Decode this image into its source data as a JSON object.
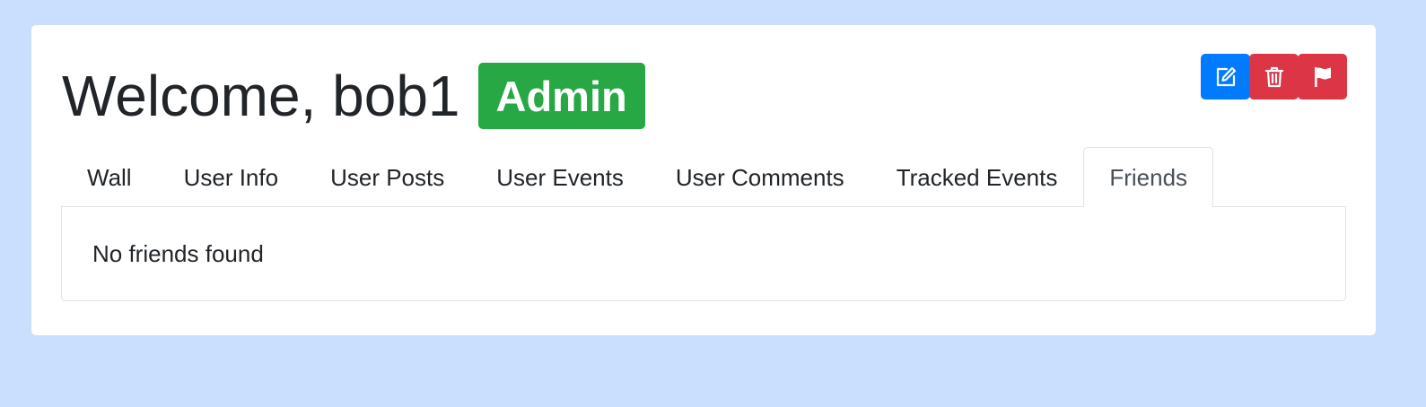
{
  "header": {
    "welcome_text": "Welcome, bob1",
    "role_badge": "Admin"
  },
  "actions": [
    {
      "icon": "edit-icon",
      "color": "#007bff"
    },
    {
      "icon": "trash-icon",
      "color": "#dc3545"
    },
    {
      "icon": "flag-icon",
      "color": "#dc3545"
    }
  ],
  "tabs": [
    {
      "label": "Wall"
    },
    {
      "label": "User Info"
    },
    {
      "label": "User Posts"
    },
    {
      "label": "User Events"
    },
    {
      "label": "User Comments"
    },
    {
      "label": "Tracked Events"
    },
    {
      "label": "Friends",
      "active": true
    }
  ],
  "content": {
    "empty_message": "No friends found"
  },
  "colors": {
    "page_background": "#cadefd",
    "badge": "#28a745",
    "primary": "#007bff",
    "danger": "#dc3545"
  }
}
